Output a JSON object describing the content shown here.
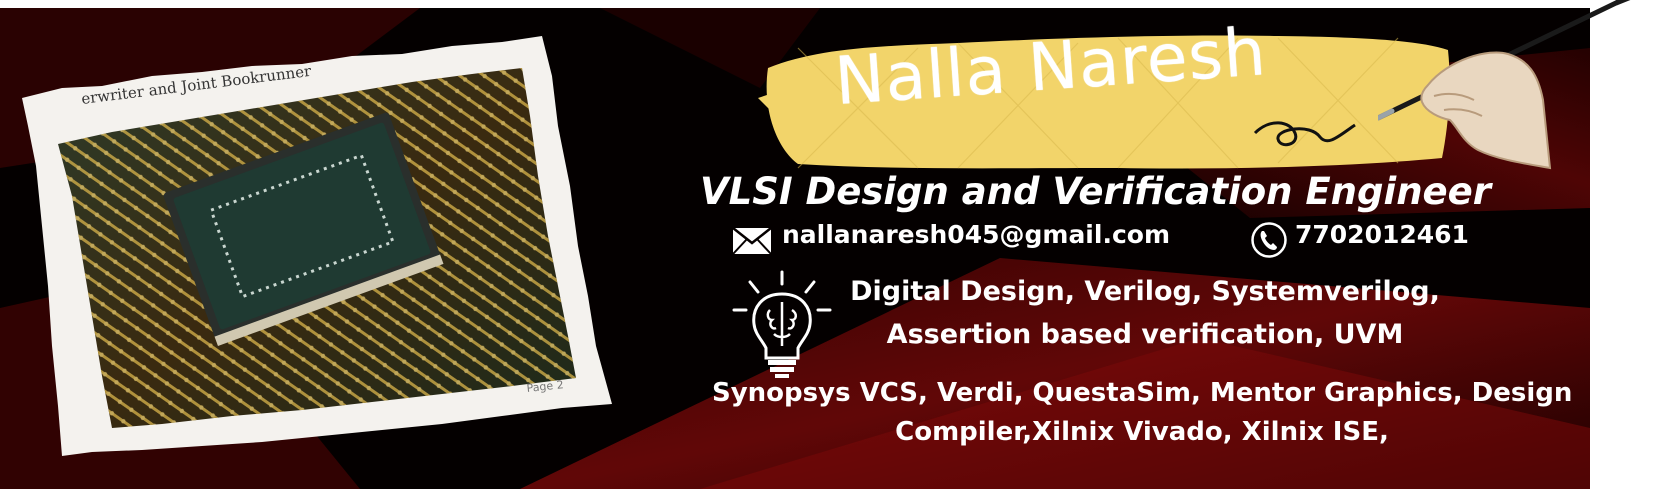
{
  "profile": {
    "name": "Nalla Naresh",
    "title": "VLSI Design and Verification Engineer"
  },
  "contact": {
    "email": "nallanaresh045@gmail.com",
    "phone": "7702012461",
    "email_icon": "mail-icon",
    "phone_icon": "phone-icon"
  },
  "skills": {
    "icon": "brain-lightbulb-icon",
    "line1": "Digital Design, Verilog, Systemverilog,",
    "line2": "Assertion based verification, UVM"
  },
  "tools": {
    "line1": "Synopsys VCS, Verdi, QuestaSim, Mentor Graphics, Design",
    "line2": "Compiler,Xilnix Vivado, Xilnix ISE,"
  },
  "photo": {
    "icon": "circuit-chip-photo",
    "paper_text_top": "erwriter and Joint Bookrunner",
    "paper_text_bottom": "Page 2"
  },
  "colors": {
    "background": "#050000",
    "accent_red": "#5a0606",
    "name_strip": "#f2d46a",
    "text": "#ffffff"
  }
}
